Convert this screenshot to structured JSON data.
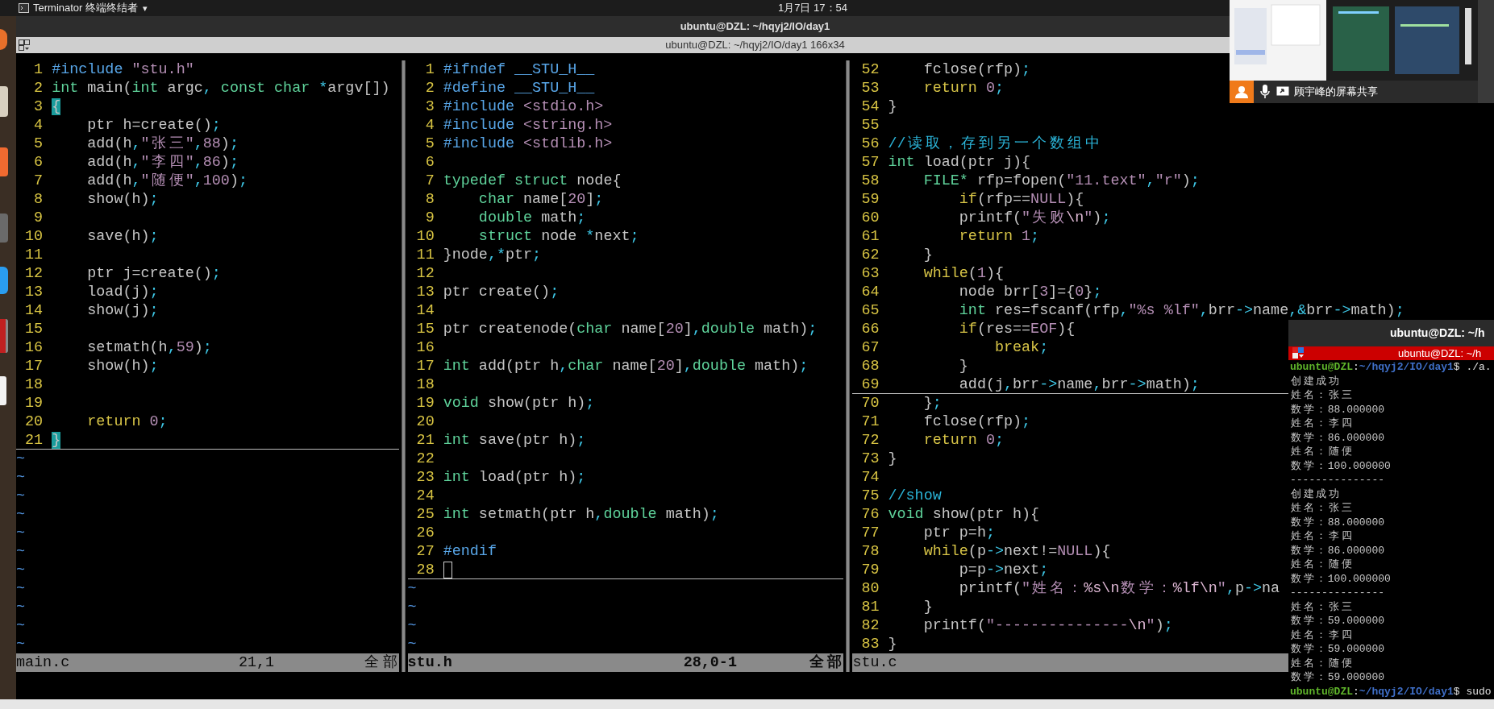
{
  "top_panel": {
    "app_menu": "Terminator 终端终结者",
    "caret": "▾",
    "clock": "1月7日 17：54"
  },
  "window": {
    "title": "ubuntu@DZL: ~/hqyj2/IO/day1",
    "terminal_title": "ubuntu@DZL: ~/hqyj2/IO/day1 166x34"
  },
  "panes": [
    {
      "lines": [
        {
          "no": "1",
          "segs": [
            {
              "kind": "pre",
              "text": "#include "
            },
            {
              "kind": "str",
              "text": "\"stu.h\""
            }
          ]
        },
        {
          "no": "2",
          "segs": [
            {
              "kind": "type",
              "text": "int"
            },
            {
              "kind": "plain",
              "text": " main("
            },
            {
              "kind": "type",
              "text": "int"
            },
            {
              "kind": "plain",
              "text": " argc"
            },
            {
              "kind": "punct",
              "text": ","
            },
            {
              "kind": "type",
              "text": " const"
            },
            {
              "kind": "type",
              "text": " char"
            },
            {
              "kind": "punct",
              "text": " *"
            },
            {
              "kind": "plain",
              "text": "argv[])"
            }
          ]
        },
        {
          "no": "3",
          "segs": [
            {
              "kind": "match",
              "text": "{"
            }
          ]
        },
        {
          "no": "4",
          "segs": [
            {
              "kind": "plain",
              "text": "    ptr h=create()"
            },
            {
              "kind": "punct",
              "text": ";"
            }
          ]
        },
        {
          "no": "5",
          "segs": [
            {
              "kind": "plain",
              "text": "    add(h"
            },
            {
              "kind": "punct",
              "text": ","
            },
            {
              "kind": "str",
              "text": "\"张三\""
            },
            {
              "kind": "punct",
              "text": ","
            },
            {
              "kind": "num",
              "text": "88"
            },
            {
              "kind": "plain",
              "text": ")"
            },
            {
              "kind": "punct",
              "text": ";"
            }
          ]
        },
        {
          "no": "6",
          "segs": [
            {
              "kind": "plain",
              "text": "    add(h"
            },
            {
              "kind": "punct",
              "text": ","
            },
            {
              "kind": "str",
              "text": "\"李四\""
            },
            {
              "kind": "punct",
              "text": ","
            },
            {
              "kind": "num",
              "text": "86"
            },
            {
              "kind": "plain",
              "text": ")"
            },
            {
              "kind": "punct",
              "text": ";"
            }
          ]
        },
        {
          "no": "7",
          "segs": [
            {
              "kind": "plain",
              "text": "    add(h"
            },
            {
              "kind": "punct",
              "text": ","
            },
            {
              "kind": "str",
              "text": "\"随便\""
            },
            {
              "kind": "punct",
              "text": ","
            },
            {
              "kind": "num",
              "text": "100"
            },
            {
              "kind": "plain",
              "text": ")"
            },
            {
              "kind": "punct",
              "text": ";"
            }
          ]
        },
        {
          "no": "8",
          "segs": [
            {
              "kind": "plain",
              "text": "    show(h)"
            },
            {
              "kind": "punct",
              "text": ";"
            }
          ]
        },
        {
          "no": "9"
        },
        {
          "no": "10",
          "segs": [
            {
              "kind": "plain",
              "text": "    save(h)"
            },
            {
              "kind": "punct",
              "text": ";"
            }
          ]
        },
        {
          "no": "11"
        },
        {
          "no": "12",
          "segs": [
            {
              "kind": "plain",
              "text": "    ptr j=create()"
            },
            {
              "kind": "punct",
              "text": ";"
            }
          ]
        },
        {
          "no": "13",
          "segs": [
            {
              "kind": "plain",
              "text": "    load(j)"
            },
            {
              "kind": "punct",
              "text": ";"
            }
          ]
        },
        {
          "no": "14",
          "segs": [
            {
              "kind": "plain",
              "text": "    show(j)"
            },
            {
              "kind": "punct",
              "text": ";"
            }
          ]
        },
        {
          "no": "15"
        },
        {
          "no": "16",
          "segs": [
            {
              "kind": "plain",
              "text": "    setmath(h"
            },
            {
              "kind": "punct",
              "text": ","
            },
            {
              "kind": "num",
              "text": "59"
            },
            {
              "kind": "plain",
              "text": ")"
            },
            {
              "kind": "punct",
              "text": ";"
            }
          ]
        },
        {
          "no": "17",
          "segs": [
            {
              "kind": "plain",
              "text": "    show(h)"
            },
            {
              "kind": "punct",
              "text": ";"
            }
          ]
        },
        {
          "no": "18"
        },
        {
          "no": "19"
        },
        {
          "no": "20",
          "segs": [
            {
              "kind": "stmt",
              "text": "    return"
            },
            {
              "kind": "num",
              "text": " 0"
            },
            {
              "kind": "punct",
              "text": ";"
            }
          ]
        },
        {
          "no": "21",
          "segs": [
            {
              "kind": "match",
              "text": "}"
            }
          ],
          "cursorline": true
        }
      ],
      "filler": [
        "~",
        "~",
        "~",
        "~",
        "~",
        "~",
        "~",
        "~",
        "~",
        "~",
        "~"
      ],
      "status": {
        "file": "main.c",
        "ruler": "21,1",
        "scroll": "全部",
        "active": false
      }
    },
    {
      "lines": [
        {
          "no": "1",
          "segs": [
            {
              "kind": "pre",
              "text": "#ifndef __STU_H__"
            }
          ]
        },
        {
          "no": "2",
          "segs": [
            {
              "kind": "pre",
              "text": "#define __STU_H__"
            }
          ]
        },
        {
          "no": "3",
          "segs": [
            {
              "kind": "pre",
              "text": "#include "
            },
            {
              "kind": "str",
              "text": "<stdio.h>"
            }
          ]
        },
        {
          "no": "4",
          "segs": [
            {
              "kind": "pre",
              "text": "#include "
            },
            {
              "kind": "str",
              "text": "<string.h>"
            }
          ]
        },
        {
          "no": "5",
          "segs": [
            {
              "kind": "pre",
              "text": "#include "
            },
            {
              "kind": "str",
              "text": "<stdlib.h>"
            }
          ]
        },
        {
          "no": "6"
        },
        {
          "no": "7",
          "segs": [
            {
              "kind": "type",
              "text": "typedef"
            },
            {
              "kind": "type",
              "text": " struct"
            },
            {
              "kind": "plain",
              "text": " node{"
            }
          ]
        },
        {
          "no": "8",
          "segs": [
            {
              "kind": "type",
              "text": "    char"
            },
            {
              "kind": "plain",
              "text": " name["
            },
            {
              "kind": "num",
              "text": "20"
            },
            {
              "kind": "plain",
              "text": "]"
            },
            {
              "kind": "punct",
              "text": ";"
            }
          ]
        },
        {
          "no": "9",
          "segs": [
            {
              "kind": "type",
              "text": "    double"
            },
            {
              "kind": "plain",
              "text": " math"
            },
            {
              "kind": "punct",
              "text": ";"
            }
          ]
        },
        {
          "no": "10",
          "segs": [
            {
              "kind": "type",
              "text": "    struct"
            },
            {
              "kind": "plain",
              "text": " node "
            },
            {
              "kind": "punct",
              "text": "*"
            },
            {
              "kind": "plain",
              "text": "next"
            },
            {
              "kind": "punct",
              "text": ";"
            }
          ]
        },
        {
          "no": "11",
          "segs": [
            {
              "kind": "plain",
              "text": "}node"
            },
            {
              "kind": "punct",
              "text": ",*"
            },
            {
              "kind": "plain",
              "text": "ptr"
            },
            {
              "kind": "punct",
              "text": ";"
            }
          ]
        },
        {
          "no": "12"
        },
        {
          "no": "13",
          "segs": [
            {
              "kind": "plain",
              "text": "ptr create()"
            },
            {
              "kind": "punct",
              "text": ";"
            }
          ]
        },
        {
          "no": "14"
        },
        {
          "no": "15",
          "segs": [
            {
              "kind": "plain",
              "text": "ptr createnode("
            },
            {
              "kind": "type",
              "text": "char"
            },
            {
              "kind": "plain",
              "text": " name["
            },
            {
              "kind": "num",
              "text": "20"
            },
            {
              "kind": "plain",
              "text": "]"
            },
            {
              "kind": "punct",
              "text": ","
            },
            {
              "kind": "type",
              "text": "double"
            },
            {
              "kind": "plain",
              "text": " math)"
            },
            {
              "kind": "punct",
              "text": ";"
            }
          ]
        },
        {
          "no": "16"
        },
        {
          "no": "17",
          "segs": [
            {
              "kind": "type",
              "text": "int"
            },
            {
              "kind": "plain",
              "text": " add(ptr h"
            },
            {
              "kind": "punct",
              "text": ","
            },
            {
              "kind": "type",
              "text": "char"
            },
            {
              "kind": "plain",
              "text": " name["
            },
            {
              "kind": "num",
              "text": "20"
            },
            {
              "kind": "plain",
              "text": "]"
            },
            {
              "kind": "punct",
              "text": ","
            },
            {
              "kind": "type",
              "text": "double"
            },
            {
              "kind": "plain",
              "text": " math)"
            },
            {
              "kind": "punct",
              "text": ";"
            }
          ]
        },
        {
          "no": "18"
        },
        {
          "no": "19",
          "segs": [
            {
              "kind": "type",
              "text": "void"
            },
            {
              "kind": "plain",
              "text": " show(ptr h)"
            },
            {
              "kind": "punct",
              "text": ";"
            }
          ]
        },
        {
          "no": "20"
        },
        {
          "no": "21",
          "segs": [
            {
              "kind": "type",
              "text": "int"
            },
            {
              "kind": "plain",
              "text": " save(ptr h)"
            },
            {
              "kind": "punct",
              "text": ";"
            }
          ]
        },
        {
          "no": "22"
        },
        {
          "no": "23",
          "segs": [
            {
              "kind": "type",
              "text": "int"
            },
            {
              "kind": "plain",
              "text": " load(ptr h)"
            },
            {
              "kind": "punct",
              "text": ";"
            }
          ]
        },
        {
          "no": "24"
        },
        {
          "no": "25",
          "segs": [
            {
              "kind": "type",
              "text": "int"
            },
            {
              "kind": "plain",
              "text": " setmath(ptr h"
            },
            {
              "kind": "punct",
              "text": ","
            },
            {
              "kind": "type",
              "text": "double"
            },
            {
              "kind": "plain",
              "text": " math)"
            },
            {
              "kind": "punct",
              "text": ";"
            }
          ]
        },
        {
          "no": "26"
        },
        {
          "no": "27",
          "segs": [
            {
              "kind": "pre",
              "text": "#endif"
            }
          ]
        },
        {
          "no": "28",
          "cursor": true,
          "cursorline": true
        }
      ],
      "filler": [
        "~",
        "~",
        "~",
        "~"
      ],
      "status": {
        "file": "stu.h",
        "ruler": "28,0-1",
        "scroll": "全部",
        "active": true
      }
    },
    {
      "lines": [
        {
          "no": "52",
          "segs": [
            {
              "kind": "plain",
              "text": "    fclose(rfp)"
            },
            {
              "kind": "punct",
              "text": ";"
            }
          ]
        },
        {
          "no": "53",
          "segs": [
            {
              "kind": "stmt",
              "text": "    return"
            },
            {
              "kind": "num",
              "text": " 0"
            },
            {
              "kind": "punct",
              "text": ";"
            }
          ]
        },
        {
          "no": "54",
          "segs": [
            {
              "kind": "plain",
              "text": "}"
            }
          ]
        },
        {
          "no": "55"
        },
        {
          "no": "56",
          "segs": [
            {
              "kind": "comment",
              "text": "//读取，存到另一个数组中"
            }
          ]
        },
        {
          "no": "57",
          "segs": [
            {
              "kind": "type",
              "text": "int"
            },
            {
              "kind": "plain",
              "text": " load(ptr j){"
            }
          ]
        },
        {
          "no": "58",
          "segs": [
            {
              "kind": "type",
              "text": "    FILE*"
            },
            {
              "kind": "plain",
              "text": " rfp=fopen("
            },
            {
              "kind": "str",
              "text": "\"11.text\""
            },
            {
              "kind": "punct",
              "text": ","
            },
            {
              "kind": "str",
              "text": "\"r\""
            },
            {
              "kind": "plain",
              "text": ")"
            },
            {
              "kind": "punct",
              "text": ";"
            }
          ]
        },
        {
          "no": "59",
          "segs": [
            {
              "kind": "stmt",
              "text": "        if"
            },
            {
              "kind": "plain",
              "text": "(rfp=="
            },
            {
              "kind": "num",
              "text": "NULL"
            },
            {
              "kind": "plain",
              "text": "){"
            }
          ]
        },
        {
          "no": "60",
          "segs": [
            {
              "kind": "plain",
              "text": "        printf("
            },
            {
              "kind": "str",
              "text": "\"失败"
            },
            {
              "kind": "esc",
              "text": "\\n"
            },
            {
              "kind": "str",
              "text": "\""
            },
            {
              "kind": "plain",
              "text": ")"
            },
            {
              "kind": "punct",
              "text": ";"
            }
          ]
        },
        {
          "no": "61",
          "segs": [
            {
              "kind": "stmt",
              "text": "        return"
            },
            {
              "kind": "num",
              "text": " 1"
            },
            {
              "kind": "punct",
              "text": ";"
            }
          ]
        },
        {
          "no": "62",
          "segs": [
            {
              "kind": "plain",
              "text": "    }"
            }
          ]
        },
        {
          "no": "63",
          "segs": [
            {
              "kind": "stmt",
              "text": "    while"
            },
            {
              "kind": "plain",
              "text": "("
            },
            {
              "kind": "num",
              "text": "1"
            },
            {
              "kind": "plain",
              "text": "){"
            }
          ]
        },
        {
          "no": "64",
          "segs": [
            {
              "kind": "plain",
              "text": "        node brr["
            },
            {
              "kind": "num",
              "text": "3"
            },
            {
              "kind": "plain",
              "text": "]={"
            },
            {
              "kind": "num",
              "text": "0"
            },
            {
              "kind": "plain",
              "text": "}"
            },
            {
              "kind": "punct",
              "text": ";"
            }
          ]
        },
        {
          "no": "65",
          "segs": [
            {
              "kind": "type",
              "text": "        int"
            },
            {
              "kind": "plain",
              "text": " res=fscanf(rfp"
            },
            {
              "kind": "punct",
              "text": ","
            },
            {
              "kind": "str",
              "text": "\"%s %lf\""
            },
            {
              "kind": "punct",
              "text": ","
            },
            {
              "kind": "plain",
              "text": "brr"
            },
            {
              "kind": "punct",
              "text": "->"
            },
            {
              "kind": "plain",
              "text": "name"
            },
            {
              "kind": "punct",
              "text": ",&"
            },
            {
              "kind": "plain",
              "text": "brr"
            },
            {
              "kind": "punct",
              "text": "->"
            },
            {
              "kind": "plain",
              "text": "math)"
            },
            {
              "kind": "punct",
              "text": ";"
            }
          ]
        },
        {
          "no": "66",
          "segs": [
            {
              "kind": "stmt",
              "text": "        if"
            },
            {
              "kind": "plain",
              "text": "(res=="
            },
            {
              "kind": "num",
              "text": "EOF"
            },
            {
              "kind": "plain",
              "text": "){"
            }
          ]
        },
        {
          "no": "67",
          "segs": [
            {
              "kind": "stmt",
              "text": "            break"
            },
            {
              "kind": "punct",
              "text": ";"
            }
          ]
        },
        {
          "no": "68",
          "segs": [
            {
              "kind": "plain",
              "text": "        }"
            }
          ]
        },
        {
          "no": "69",
          "segs": [
            {
              "kind": "plain",
              "text": "        add(j"
            },
            {
              "kind": "punct",
              "text": ","
            },
            {
              "kind": "plain",
              "text": "brr"
            },
            {
              "kind": "punct",
              "text": "->"
            },
            {
              "kind": "plain",
              "text": "name"
            },
            {
              "kind": "punct",
              "text": ","
            },
            {
              "kind": "plain",
              "text": "brr"
            },
            {
              "kind": "punct",
              "text": "->"
            },
            {
              "kind": "plain",
              "text": "math)"
            },
            {
              "kind": "punct",
              "text": ";"
            }
          ],
          "cursorline": true
        },
        {
          "no": "70",
          "segs": [
            {
              "kind": "plain",
              "text": "    }"
            },
            {
              "kind": "punct",
              "text": ";"
            }
          ]
        },
        {
          "no": "71",
          "segs": [
            {
              "kind": "plain",
              "text": "    fclose(rfp)"
            },
            {
              "kind": "punct",
              "text": ";"
            }
          ]
        },
        {
          "no": "72",
          "segs": [
            {
              "kind": "stmt",
              "text": "    return"
            },
            {
              "kind": "num",
              "text": " 0"
            },
            {
              "kind": "punct",
              "text": ";"
            }
          ]
        },
        {
          "no": "73",
          "segs": [
            {
              "kind": "plain",
              "text": "}"
            }
          ]
        },
        {
          "no": "74"
        },
        {
          "no": "75",
          "segs": [
            {
              "kind": "comment",
              "text": "//show"
            }
          ]
        },
        {
          "no": "76",
          "segs": [
            {
              "kind": "type",
              "text": "void"
            },
            {
              "kind": "plain",
              "text": " show(ptr h){"
            }
          ]
        },
        {
          "no": "77",
          "segs": [
            {
              "kind": "plain",
              "text": "    ptr p=h"
            },
            {
              "kind": "punct",
              "text": ";"
            }
          ]
        },
        {
          "no": "78",
          "segs": [
            {
              "kind": "stmt",
              "text": "    while"
            },
            {
              "kind": "plain",
              "text": "(p"
            },
            {
              "kind": "punct",
              "text": "->"
            },
            {
              "kind": "plain",
              "text": "next!="
            },
            {
              "kind": "num",
              "text": "NULL"
            },
            {
              "kind": "plain",
              "text": "){"
            }
          ]
        },
        {
          "no": "79",
          "segs": [
            {
              "kind": "plain",
              "text": "        p=p"
            },
            {
              "kind": "punct",
              "text": "->"
            },
            {
              "kind": "plain",
              "text": "next"
            },
            {
              "kind": "punct",
              "text": ";"
            }
          ]
        },
        {
          "no": "80",
          "segs": [
            {
              "kind": "plain",
              "text": "        printf("
            },
            {
              "kind": "str",
              "text": "\"姓名："
            },
            {
              "kind": "esc",
              "text": "%s\\n"
            },
            {
              "kind": "str",
              "text": "数学："
            },
            {
              "kind": "esc",
              "text": "%lf\\n"
            },
            {
              "kind": "str",
              "text": "\""
            },
            {
              "kind": "punct",
              "text": ","
            },
            {
              "kind": "plain",
              "text": "p"
            },
            {
              "kind": "punct",
              "text": "->"
            },
            {
              "kind": "plain",
              "text": "na"
            }
          ]
        },
        {
          "no": "81",
          "segs": [
            {
              "kind": "plain",
              "text": "    }"
            }
          ]
        },
        {
          "no": "82",
          "segs": [
            {
              "kind": "plain",
              "text": "    printf("
            },
            {
              "kind": "str",
              "text": "\"---------------"
            },
            {
              "kind": "esc",
              "text": "\\n"
            },
            {
              "kind": "str",
              "text": "\""
            },
            {
              "kind": "plain",
              "text": ")"
            },
            {
              "kind": "punct",
              "text": ";"
            }
          ]
        },
        {
          "no": "83",
          "segs": [
            {
              "kind": "plain",
              "text": "}"
            }
          ]
        }
      ],
      "status": {
        "file": "stu.c",
        "active": false
      }
    }
  ],
  "screen_share": {
    "label": "顾宇峰的屏幕共享"
  },
  "popup_terminal": {
    "window_title": "ubuntu@DZL: ~/h",
    "tab_title": "ubuntu@DZL: ~/h",
    "lines": [
      {
        "kind": "prompt",
        "user": "ubuntu@DZL",
        "sep": ":",
        "path": "~/hqyj2/IO/day1",
        "tail": "$ ./a."
      },
      {
        "kind": "output",
        "text": "创建成功"
      },
      {
        "kind": "output",
        "text": "姓名：张三"
      },
      {
        "kind": "output",
        "text": "数学：88.000000"
      },
      {
        "kind": "output",
        "text": "姓名：李四"
      },
      {
        "kind": "output",
        "text": "数学：86.000000"
      },
      {
        "kind": "output",
        "text": "姓名：随便"
      },
      {
        "kind": "output",
        "text": "数学：100.000000"
      },
      {
        "kind": "output",
        "text": "---------------"
      },
      {
        "kind": "output",
        "text": "创建成功"
      },
      {
        "kind": "output",
        "text": "姓名：张三"
      },
      {
        "kind": "output",
        "text": "数学：88.000000"
      },
      {
        "kind": "output",
        "text": "姓名：李四"
      },
      {
        "kind": "output",
        "text": "数学：86.000000"
      },
      {
        "kind": "output",
        "text": "姓名：随便"
      },
      {
        "kind": "output",
        "text": "数学：100.000000"
      },
      {
        "kind": "output",
        "text": "---------------"
      },
      {
        "kind": "output",
        "text": "姓名：张三"
      },
      {
        "kind": "output",
        "text": "数学：59.000000"
      },
      {
        "kind": "output",
        "text": "姓名：李四"
      },
      {
        "kind": "output",
        "text": "数学：59.000000"
      },
      {
        "kind": "output",
        "text": "姓名：随便"
      },
      {
        "kind": "output",
        "text": "数学：59.000000"
      },
      {
        "kind": "prompt",
        "user": "ubuntu@DZL",
        "sep": ":",
        "path": "~/hqyj2/IO/day1",
        "tail": "$ sudo"
      }
    ]
  }
}
